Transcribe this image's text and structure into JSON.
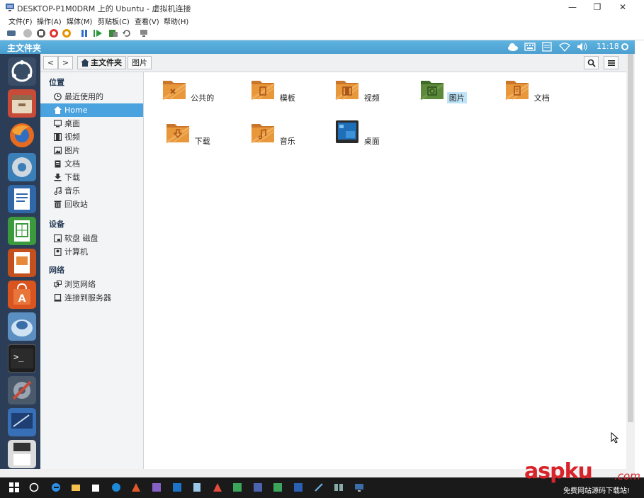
{
  "window": {
    "title": "DESKTOP-P1M0DRM 上的 Ubuntu - 虚拟机连接",
    "minimize": "—",
    "restore": "❐",
    "close": "✕"
  },
  "menu": [
    "文件(F)",
    "操作(A)",
    "媒体(M)",
    "剪贴板(C)",
    "查看(V)",
    "帮助(H)"
  ],
  "panel": {
    "title": "主文件夹",
    "clock": "11:18"
  },
  "nav": {
    "back": "<",
    "forward": ">",
    "crumbs": [
      "主文件夹",
      "图片"
    ],
    "search_icon": "search-icon",
    "list_icon": "list-view-icon"
  },
  "sidebar": {
    "sections": [
      {
        "title": "位置",
        "items": [
          {
            "label": "最近使用的",
            "icon": "clock-icon"
          },
          {
            "label": "Home",
            "icon": "home-icon",
            "selected": true
          },
          {
            "label": "桌面",
            "icon": "desktop-icon"
          },
          {
            "label": "视频",
            "icon": "video-icon"
          },
          {
            "label": "图片",
            "icon": "picture-icon"
          },
          {
            "label": "文档",
            "icon": "document-icon"
          },
          {
            "label": "下载",
            "icon": "download-icon"
          },
          {
            "label": "音乐",
            "icon": "music-icon"
          },
          {
            "label": "回收站",
            "icon": "trash-icon"
          }
        ]
      },
      {
        "title": "设备",
        "items": [
          {
            "label": "软盘 磁盘",
            "icon": "floppy-icon"
          },
          {
            "label": "计算机",
            "icon": "computer-icon"
          }
        ]
      },
      {
        "title": "网络",
        "items": [
          {
            "label": "浏览网络",
            "icon": "network-icon"
          },
          {
            "label": "连接到服务器",
            "icon": "server-icon"
          }
        ]
      }
    ]
  },
  "files": [
    {
      "label": "公共的",
      "icon": "folder-public-icon"
    },
    {
      "label": "模板",
      "icon": "folder-templates-icon"
    },
    {
      "label": "视频",
      "icon": "folder-videos-icon"
    },
    {
      "label": "图片",
      "icon": "folder-pictures-icon",
      "selected": true
    },
    {
      "label": "文档",
      "icon": "folder-documents-icon"
    },
    {
      "label": "下载",
      "icon": "folder-downloads-icon"
    },
    {
      "label": "音乐",
      "icon": "folder-music-icon"
    },
    {
      "label": "桌面",
      "icon": "desktop-folder-icon"
    }
  ],
  "watermark": {
    "brand_a": "aspku",
    "brand_b": ".com",
    "tagline": "免费网站源码下载站!"
  },
  "colors": {
    "panel": "#4a9fd0",
    "launcher": "#2c3e57",
    "selection": "#4aa3df",
    "folder": "#e8973a",
    "folder_selected": "#5c8a3a"
  }
}
